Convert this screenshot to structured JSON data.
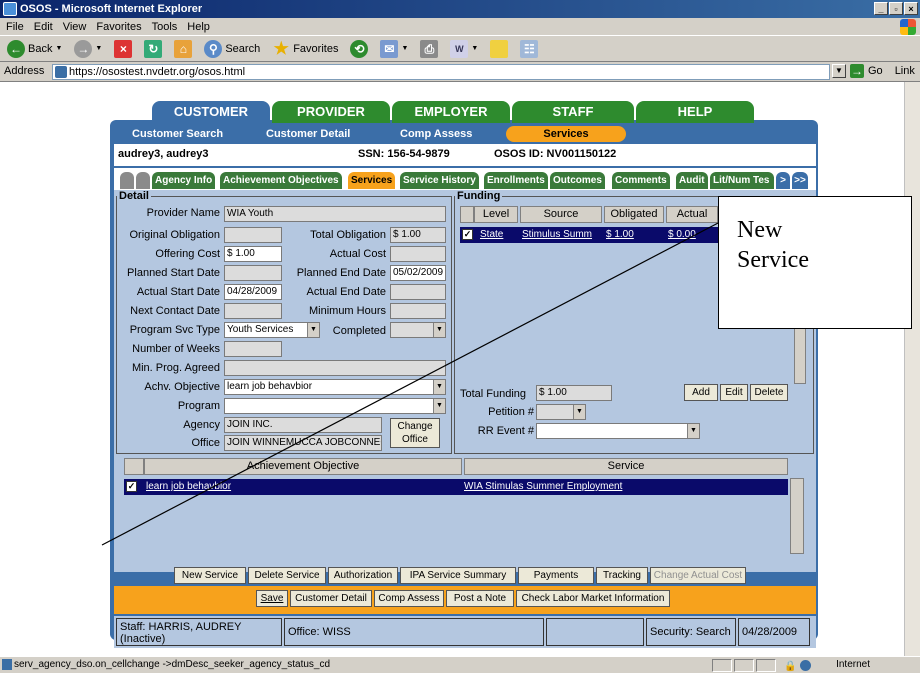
{
  "window": {
    "title": "OSOS - Microsoft Internet Explorer"
  },
  "menu": [
    "File",
    "Edit",
    "View",
    "Favorites",
    "Tools",
    "Help"
  ],
  "toolbar": {
    "back": "Back",
    "search": "Search",
    "favorites": "Favorites"
  },
  "address": {
    "label": "Address",
    "url": "https://osostest.nvdetr.org/osos.html",
    "go": "Go",
    "links": "Link"
  },
  "maintabs": [
    "CUSTOMER",
    "PROVIDER",
    "EMPLOYER",
    "STAFF",
    "HELP"
  ],
  "subnav": {
    "customer_search": "Customer Search",
    "customer_detail": "Customer Detail",
    "comp_assess": "Comp Assess",
    "services": "Services"
  },
  "info": {
    "name": "audrey3, audrey3",
    "ssn": "SSN: 156-54-9879",
    "osos_id": "OSOS ID: NV001150122"
  },
  "tabs": [
    "Agency Info",
    "Achievement Objectives",
    "Services",
    "Service History",
    "Enrollments",
    "Outcomes",
    "Comments",
    "Audit",
    "Lit/Num Tes"
  ],
  "detail": {
    "legend": "Detail",
    "provider_name_label": "Provider Name",
    "provider_name": "WIA Youth",
    "original_obligation_label": "Original Obligation",
    "total_obligation_label": "Total Obligation",
    "total_obligation": "$ 1.00",
    "offering_cost_label": "Offering Cost",
    "offering_cost": "$ 1.00",
    "actual_cost_label": "Actual Cost",
    "planned_start_label": "Planned Start Date",
    "planned_end_label": "Planned End Date",
    "planned_end": "05/02/2009",
    "actual_start_label": "Actual Start Date",
    "actual_start": "04/28/2009",
    "actual_end_label": "Actual End Date",
    "next_contact_label": "Next Contact Date",
    "min_hours_label": "Minimum Hours",
    "program_svc_type_label": "Program Svc Type",
    "program_svc_type": "Youth Services",
    "completed_label": "Completed",
    "number_weeks_label": "Number of Weeks",
    "min_prog_label": "Min. Prog. Agreed",
    "achv_objective_label": "Achv. Objective",
    "achv_objective": "learn job behavbior",
    "program_label": "Program",
    "agency_label": "Agency",
    "agency": "JOIN INC.",
    "office_label": "Office",
    "office": "JOIN WINNEMUCCA JOBCONNEC",
    "change_office_1": "Change",
    "change_office_2": "Office"
  },
  "funding": {
    "legend": "Funding",
    "headers": [
      "Level",
      "Source",
      "Obligated",
      "Actual"
    ],
    "row": {
      "level": "State",
      "source": "Stimulus Summ",
      "obligated": "$ 1.00",
      "actual": "$ 0.00"
    },
    "total_funding_label": "Total Funding",
    "total_funding": "$ 1.00",
    "petition_label": "Petition #",
    "rr_event_label": "RR Event #",
    "add": "Add",
    "edit": "Edit",
    "delete": "Delete"
  },
  "objectives": {
    "headers": [
      "Achievement Objective",
      "Service"
    ],
    "row": {
      "objective": "learn job behavbior",
      "service": "WIA Stimulas Summer Employment"
    }
  },
  "actions": [
    "New Service",
    "Delete Service",
    "Authorization",
    "IPA Service Summary",
    "Payments",
    "Tracking",
    "Change Actual Cost"
  ],
  "bottom": [
    "Save",
    "Customer Detail",
    "Comp Assess",
    "Post a Note",
    "Check Labor Market Information"
  ],
  "footer": {
    "staff_1": "Staff: HARRIS, AUDREY",
    "staff_2": "(Inactive)",
    "office": "Office: WISS",
    "security": "Security: Search",
    "date": "04/28/2009"
  },
  "statusbar": {
    "message": "serv_agency_dso.on_cellchange ->dmDesc_seeker_agency_status_cd",
    "zone": "Internet"
  },
  "callout": {
    "line1": "New",
    "line2": "Service"
  },
  "colors": {
    "title_blue": "#0a246a",
    "app_blue": "#3b6ea8",
    "tab_green": "#2e8b2e",
    "orange": "#f7a21c",
    "navy": "#0a0a6a",
    "panel": "#b4c7e0"
  }
}
